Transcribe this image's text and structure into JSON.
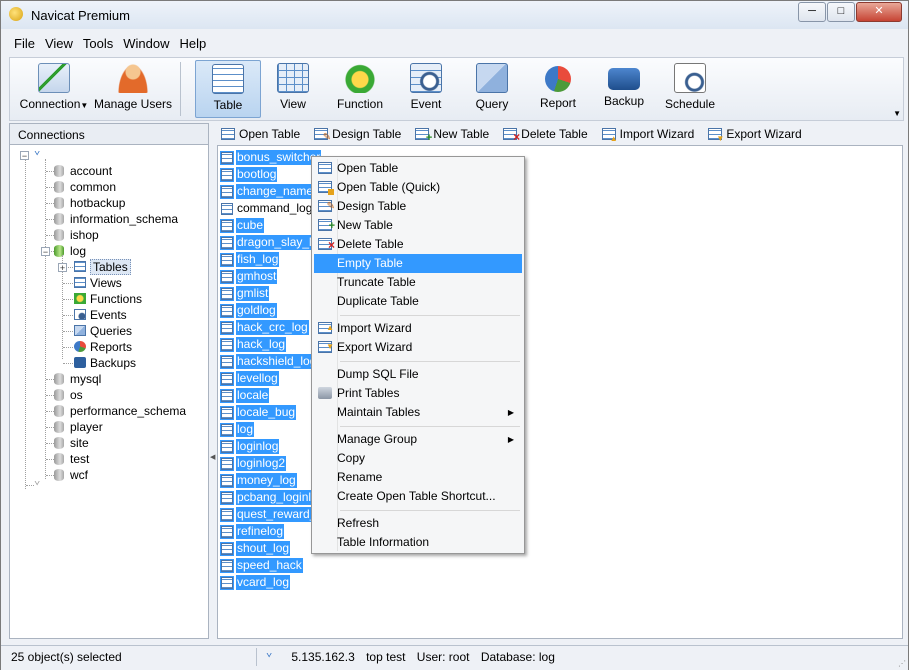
{
  "window": {
    "title": "Navicat Premium",
    "minimize": "─",
    "maximize": "□",
    "close": "✕"
  },
  "menu": [
    "File",
    "View",
    "Tools",
    "Window",
    "Help"
  ],
  "toolbar": {
    "connection": "Connection",
    "manage_users": "Manage Users",
    "table": "Table",
    "view": "View",
    "function": "Function",
    "event": "Event",
    "query": "Query",
    "report": "Report",
    "backup": "Backup",
    "schedule": "Schedule"
  },
  "sidebar": {
    "header": "Connections",
    "databases_top": [
      "account",
      "common",
      "hotbackup",
      "information_schema",
      "ishop",
      "log"
    ],
    "log_children": [
      "Tables",
      "Views",
      "Functions",
      "Events",
      "Queries",
      "Reports",
      "Backups"
    ],
    "databases_bottom": [
      "mysql",
      "os",
      "performance_schema",
      "player",
      "site",
      "test",
      "wcf"
    ]
  },
  "object_toolbar": {
    "open_table": "Open Table",
    "design_table": "Design Table",
    "new_table": "New Table",
    "delete_table": "Delete Table",
    "import_wizard": "Import Wizard",
    "export_wizard": "Export Wizard"
  },
  "tables": [
    "bonus_switcher",
    "bootlog",
    "change_name",
    "command_log",
    "cube",
    "dragon_slay_log",
    "fish_log",
    "gmhost",
    "gmlist",
    "goldlog",
    "hack_crc_log",
    "hack_log",
    "hackshield_log",
    "levellog",
    "locale",
    "locale_bug",
    "log",
    "loginlog",
    "loginlog2",
    "money_log",
    "pcbang_loginlog",
    "quest_reward_l",
    "refinelog",
    "shout_log",
    "speed_hack",
    "vcard_log"
  ],
  "context_menu": {
    "open_table": "Open Table",
    "open_table_quick": "Open Table (Quick)",
    "design_table": "Design Table",
    "new_table": "New Table",
    "delete_table": "Delete Table",
    "empty_table": "Empty Table",
    "truncate_table": "Truncate Table",
    "duplicate_table": "Duplicate Table",
    "import_wizard": "Import Wizard",
    "export_wizard": "Export Wizard",
    "dump_sql_file": "Dump SQL File",
    "print_tables": "Print Tables",
    "maintain_tables": "Maintain Tables",
    "manage_group": "Manage Group",
    "copy": "Copy",
    "rename": "Rename",
    "create_shortcut": "Create Open Table Shortcut...",
    "refresh": "Refresh",
    "table_information": "Table Information"
  },
  "status": {
    "selected": "25 object(s) selected",
    "host": "5.135.162.3",
    "connection": "top test",
    "user": "User: root",
    "database": "Database: log"
  },
  "colors": {
    "selection": "#3399ff",
    "toolbar_active": "#b9d4f0"
  }
}
